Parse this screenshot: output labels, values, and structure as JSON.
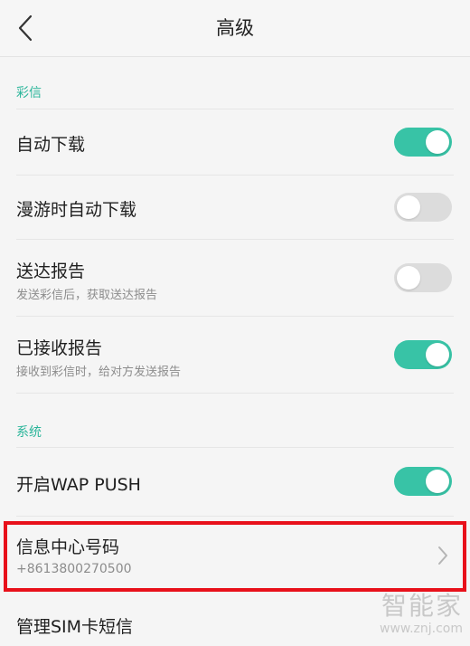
{
  "header": {
    "title": "高级"
  },
  "sections": {
    "mms": "彩信",
    "system": "系统"
  },
  "rows": {
    "auto_download": {
      "title": "自动下载",
      "toggle": true
    },
    "roaming_download": {
      "title": "漫游时自动下载",
      "toggle": false
    },
    "delivery_report": {
      "title": "送达报告",
      "subtitle": "发送彩信后，获取送达报告",
      "toggle": false
    },
    "read_report": {
      "title": "已接收报告",
      "subtitle": "接收到彩信时，给对方发送报告",
      "toggle": true
    },
    "wap_push": {
      "title": "开启WAP PUSH",
      "toggle": true
    },
    "message_center": {
      "title": "信息中心号码",
      "subtitle": "+8613800270500"
    },
    "sim_messages": {
      "title": "管理SIM卡短信"
    }
  },
  "watermark": {
    "brand": "智能家",
    "url": "www.znj.com"
  },
  "colors": {
    "accent": "#38c3a6",
    "section_text": "#2bb59a",
    "highlight": "#e8101a",
    "toggle_off": "#dcdcdc"
  },
  "icons": {
    "back": "chevron-left-icon",
    "row_arrow": "chevron-right-icon"
  }
}
